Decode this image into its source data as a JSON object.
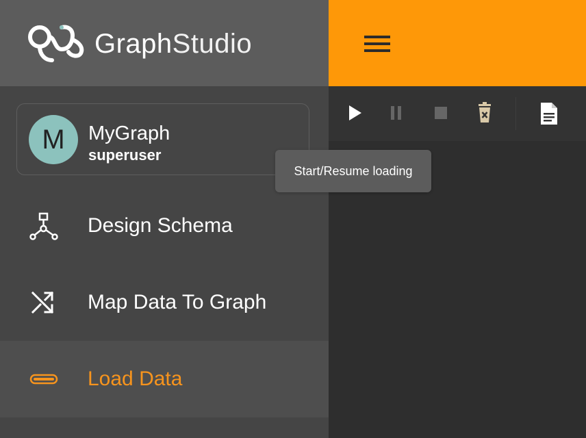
{
  "brand": {
    "name_part1": "Graph",
    "name_part2": "Studio",
    "logo_icon": "graphstudio-logo-icon"
  },
  "graph": {
    "avatar_letter": "M",
    "name": "MyGraph",
    "user": "superuser",
    "avatar_color": "#8cc2bd"
  },
  "nav": {
    "items": [
      {
        "label": "Design Schema",
        "icon": "schema-icon",
        "active": false
      },
      {
        "label": "Map Data To Graph",
        "icon": "shuffle-icon",
        "active": false
      },
      {
        "label": "Load Data",
        "icon": "load-bar-icon",
        "active": true
      }
    ]
  },
  "topbar": {
    "menu_icon": "hamburger-menu-icon",
    "color": "#fe9808"
  },
  "toolbar": {
    "buttons": [
      {
        "name": "start-resume-button",
        "icon": "play-icon",
        "enabled": true
      },
      {
        "name": "pause-button",
        "icon": "pause-icon",
        "enabled": false
      },
      {
        "name": "stop-button",
        "icon": "stop-icon",
        "enabled": false
      },
      {
        "name": "clear-button",
        "icon": "trash-icon",
        "enabled": true
      },
      {
        "name": "log-button",
        "icon": "document-icon",
        "enabled": true
      }
    ]
  },
  "tooltip": {
    "text": "Start/Resume loading"
  },
  "colors": {
    "accent": "#f7941d",
    "sidebar": "#454545",
    "brand_bar": "#5c5c5c"
  }
}
